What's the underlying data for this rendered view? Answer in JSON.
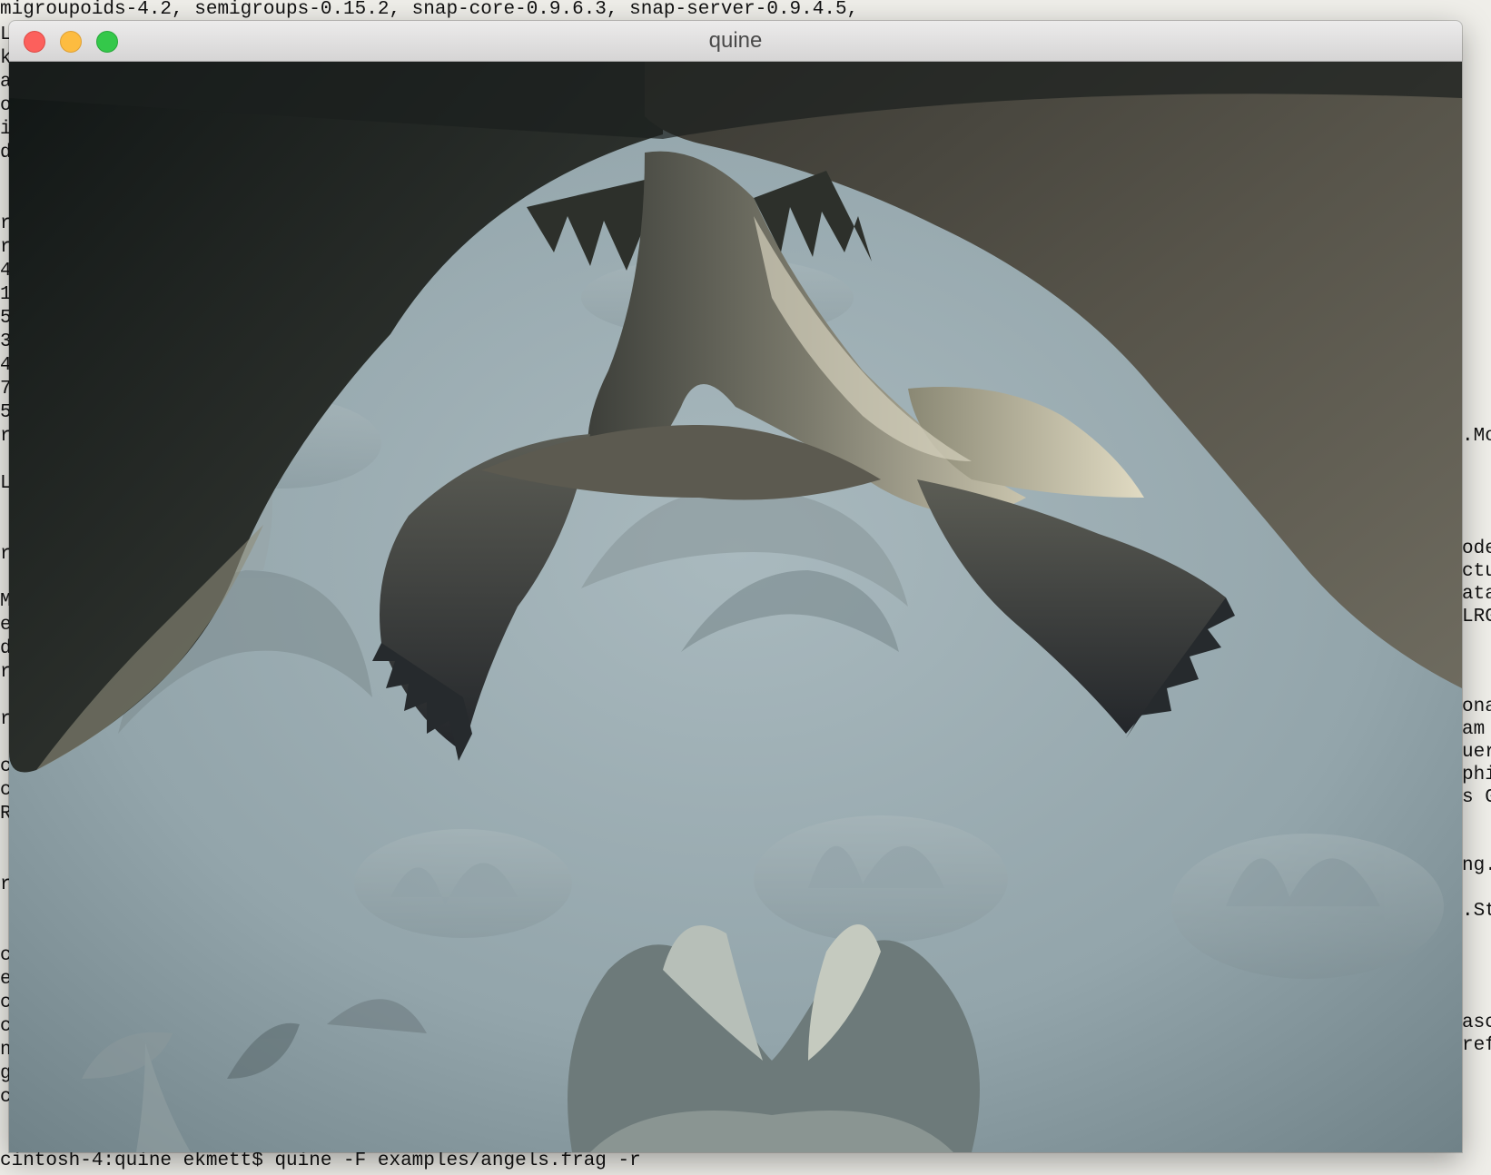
{
  "terminal": {
    "top_line": "migroupoids-4.2, semigroups-0.15.2, snap-core-0.9.6.3, snap-server-0.9.4.5,",
    "bottom_line": "cintosh-4:quine ekmett$ quine -F examples/angels.frag -r",
    "left_column": [
      "L",
      "k",
      "a",
      "o",
      "i",
      "d",
      "",
      "",
      "r",
      "r",
      "4",
      "1",
      "5",
      "3",
      "4",
      "7",
      "5",
      "r",
      "",
      "L",
      "",
      "",
      "r",
      "",
      "M",
      "e",
      "d",
      "r",
      "",
      "r",
      "",
      "c",
      "c",
      "R",
      "",
      "",
      "r",
      "",
      "",
      "c",
      "e",
      "c",
      "c",
      "n",
      "g",
      "c"
    ],
    "right_fragments": [
      {
        "row": 0,
        "text": ".Mo"
      },
      {
        "row": 1,
        "text": "ode"
      },
      {
        "row": 2,
        "text": "ctu"
      },
      {
        "row": 3,
        "text": "ata"
      },
      {
        "row": 4,
        "text": "LRG"
      },
      {
        "row": 5,
        "text": "ona"
      },
      {
        "row": 6,
        "text": "am"
      },
      {
        "row": 7,
        "text": "uer"
      },
      {
        "row": 8,
        "text": "phi"
      },
      {
        "row": 9,
        "text": "s G"
      },
      {
        "row": 10,
        "text": "ng."
      },
      {
        "row": 11,
        "text": ".St"
      },
      {
        "row": 12,
        "text": "asc"
      },
      {
        "row": 13,
        "text": "ref"
      }
    ]
  },
  "window": {
    "title": "quine",
    "buttons": {
      "close": "close",
      "minimize": "minimize",
      "maximize": "maximize"
    }
  },
  "scene": {
    "description_icon": "raymarched-fractal-angels-render",
    "colors": {
      "fog": "#9fb0b6",
      "fog_dark": "#7f9197",
      "foreground_dark": "#1f2322",
      "foreground_mid": "#4b4c46",
      "highlight": "#d8d2bc"
    }
  }
}
